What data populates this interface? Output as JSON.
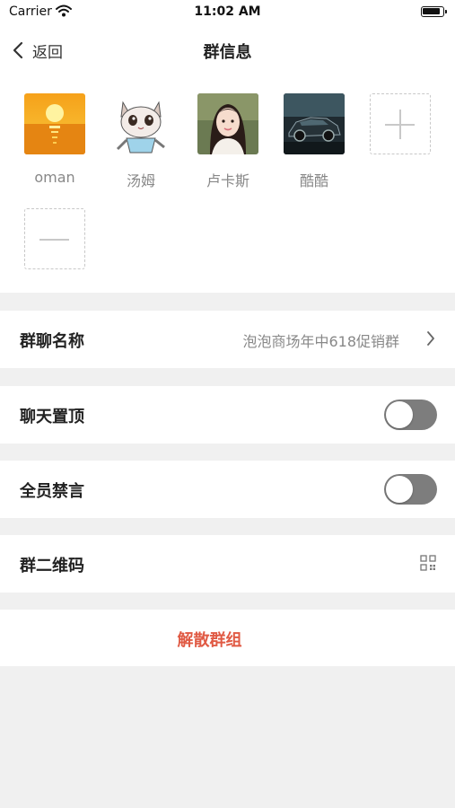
{
  "status_bar": {
    "carrier": "Carrier",
    "time": "11:02 AM"
  },
  "nav": {
    "back_label": "返回",
    "title": "群信息"
  },
  "members": [
    {
      "name": "oman",
      "avatar": "sunset-avatar"
    },
    {
      "name": "汤姆",
      "avatar": "cat-avatar"
    },
    {
      "name": "卢卡斯",
      "avatar": "girl-avatar"
    },
    {
      "name": "酷酷",
      "avatar": "car-avatar"
    }
  ],
  "settings": {
    "group_name": {
      "label": "群聊名称",
      "value": "泡泡商场年中618促销群"
    },
    "pin_chat": {
      "label": "聊天置顶",
      "enabled": false
    },
    "mute_all": {
      "label": "全员禁言",
      "enabled": false
    },
    "qr_code": {
      "label": "群二维码"
    }
  },
  "actions": {
    "disband_label": "解散群组"
  },
  "colors": {
    "danger": "#e05a44",
    "toggle_off": "#7d7d7d",
    "background": "#f0f0f0"
  }
}
